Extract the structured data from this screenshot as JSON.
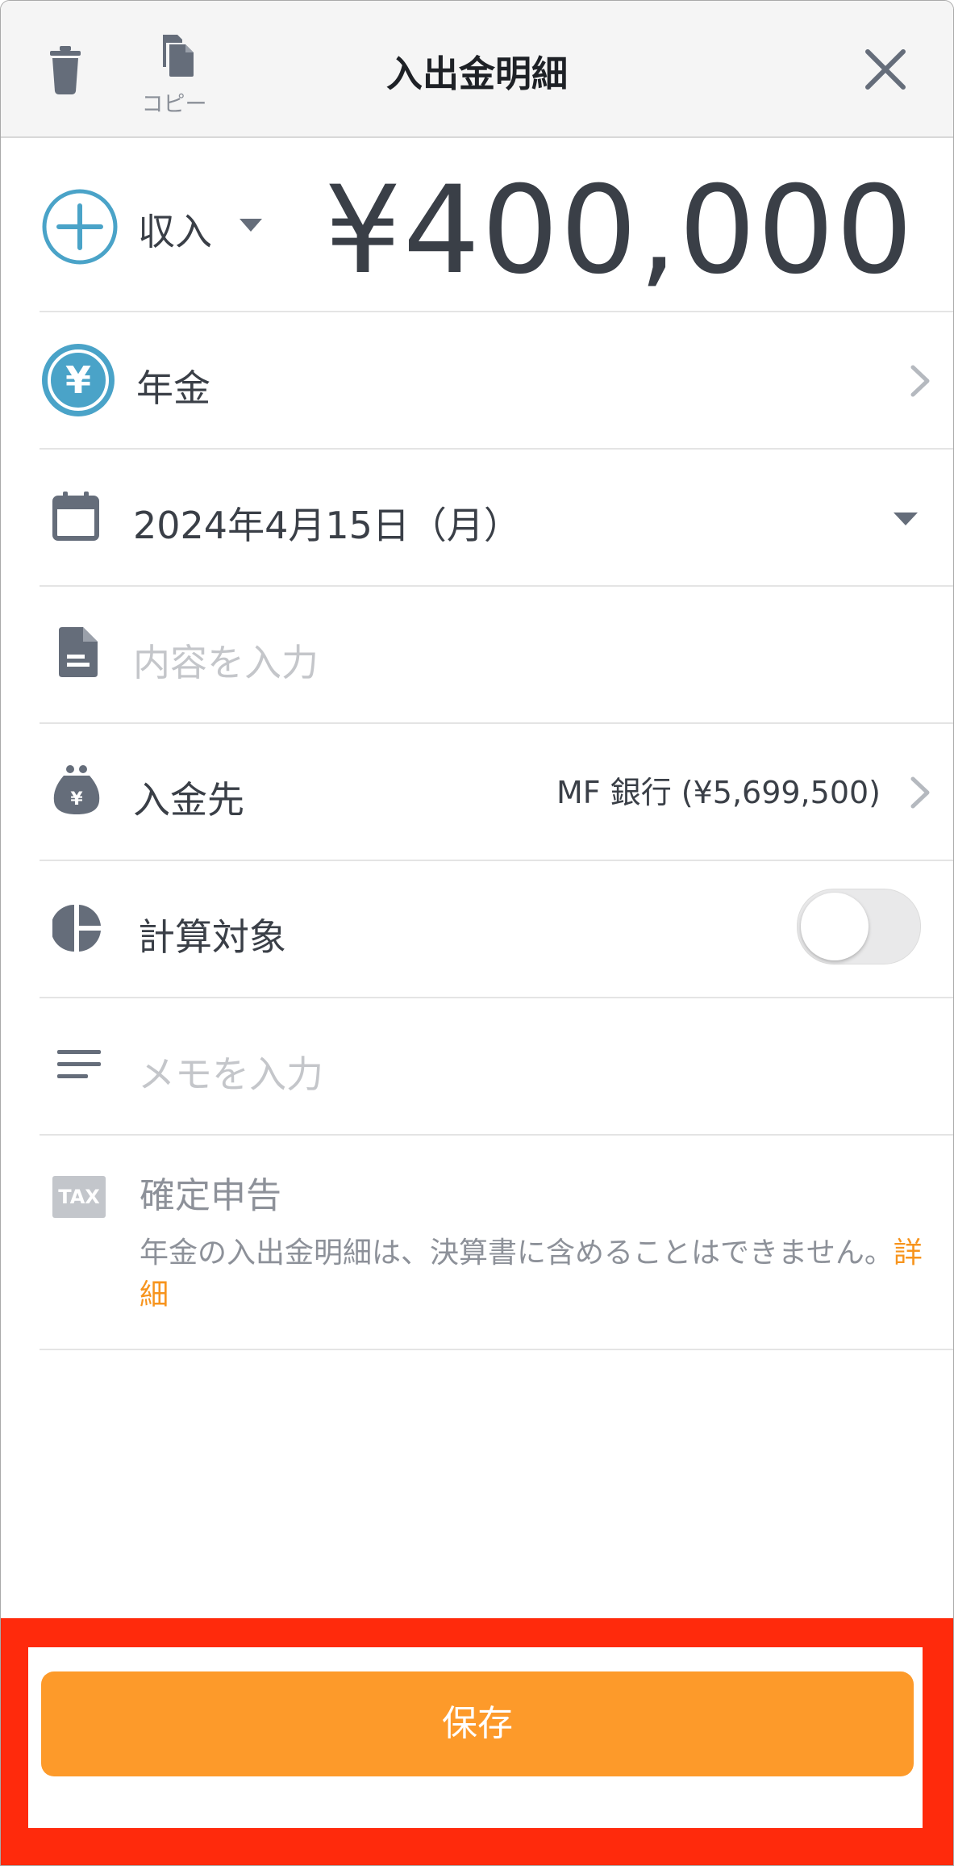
{
  "header": {
    "title": "入出金明細",
    "copy_label": "コピー",
    "icons": [
      "trash-icon",
      "copy-icon",
      "close-icon"
    ]
  },
  "amount": {
    "type_label": "収入",
    "value": "¥400,000"
  },
  "category": {
    "label": "年金"
  },
  "date": {
    "value": "2024年4月15日（月）"
  },
  "content": {
    "placeholder": "内容を入力"
  },
  "account": {
    "label": "入金先",
    "value": "MF 銀行 (¥5,699,500)"
  },
  "calculation": {
    "label": "計算対象",
    "enabled": false
  },
  "memo": {
    "placeholder": "メモを入力"
  },
  "tax": {
    "badge": "TAX",
    "title": "確定申告",
    "note": "年金の入出金明細は、決算書に含めることはできません。",
    "link": "詳細"
  },
  "save": {
    "label": "保存"
  },
  "colors": {
    "accent": "#f7941d",
    "save_button": "#fd9a2a",
    "highlight": "#ff2a0c",
    "income_blue": "#4aa3c8",
    "icon_gray": "#656d7a"
  }
}
